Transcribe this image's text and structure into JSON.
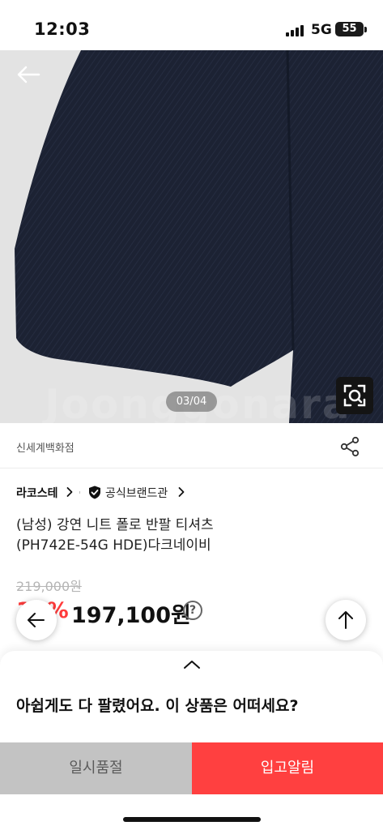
{
  "status_bar": {
    "time": "12:03",
    "network": "5G",
    "battery": "55"
  },
  "image": {
    "counter": "03/04",
    "watermark": "Joonggonara"
  },
  "seller": {
    "store_name": "신세계백화점"
  },
  "brand": {
    "name": "라코스테",
    "official_label": "공식브랜드관"
  },
  "product": {
    "title_line1": "(남성) 강연 니트 폴로 반팔 티셔츠",
    "title_line2": "(PH742E-54G HDE)다크네이비"
  },
  "price": {
    "original": "219,000원",
    "discount": "10%",
    "sale": "197,100원",
    "help_symbol": "?"
  },
  "sheet": {
    "title": "아쉽게도 다 팔렸어요. 이 상품은 어떠세요?"
  },
  "actions": {
    "soldout_label": "일시품절",
    "notify_label": "입고알림"
  },
  "colors": {
    "accent": "#ff4040",
    "discount": "#ff3b3b",
    "garment": "#1c2233"
  },
  "icons": [
    "back-arrow-icon",
    "scan-icon",
    "share-icon",
    "chevron-right-icon",
    "shield-check-icon",
    "help-icon",
    "arrow-up-icon",
    "chevron-up-icon"
  ]
}
